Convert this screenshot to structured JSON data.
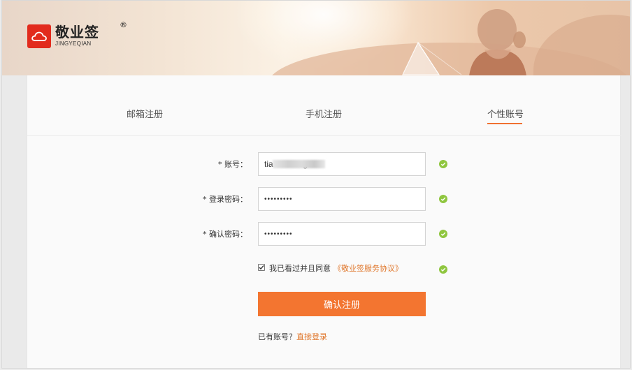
{
  "brand": {
    "name_cn": "敬业签",
    "name_en": "JINGYEQIAN",
    "registered": "®"
  },
  "tabs": [
    {
      "label": "邮箱注册",
      "active": false
    },
    {
      "label": "手机注册",
      "active": false
    },
    {
      "label": "个性账号",
      "active": true
    }
  ],
  "form": {
    "account": {
      "label": "* 账号：",
      "value": "tia           sg",
      "valid": true
    },
    "password": {
      "label": "* 登录密码：",
      "value": "•••••••••",
      "valid": true
    },
    "confirm": {
      "label": "* 确认密码：",
      "value": "•••••••••",
      "valid": true
    },
    "agreement": {
      "checked": true,
      "text": "我已看过并且同意",
      "link": "《敬业签服务协议》",
      "valid": true
    },
    "submit_label": "确认注册",
    "login_prompt": "已有账号？",
    "login_link": "直接登录"
  },
  "colors": {
    "accent": "#f37530",
    "link": "#e0772c",
    "valid": "#8fc63f",
    "logo_red": "#e22b1d"
  },
  "icons": {
    "logo": "cloud-icon",
    "valid": "check-circle-icon"
  }
}
